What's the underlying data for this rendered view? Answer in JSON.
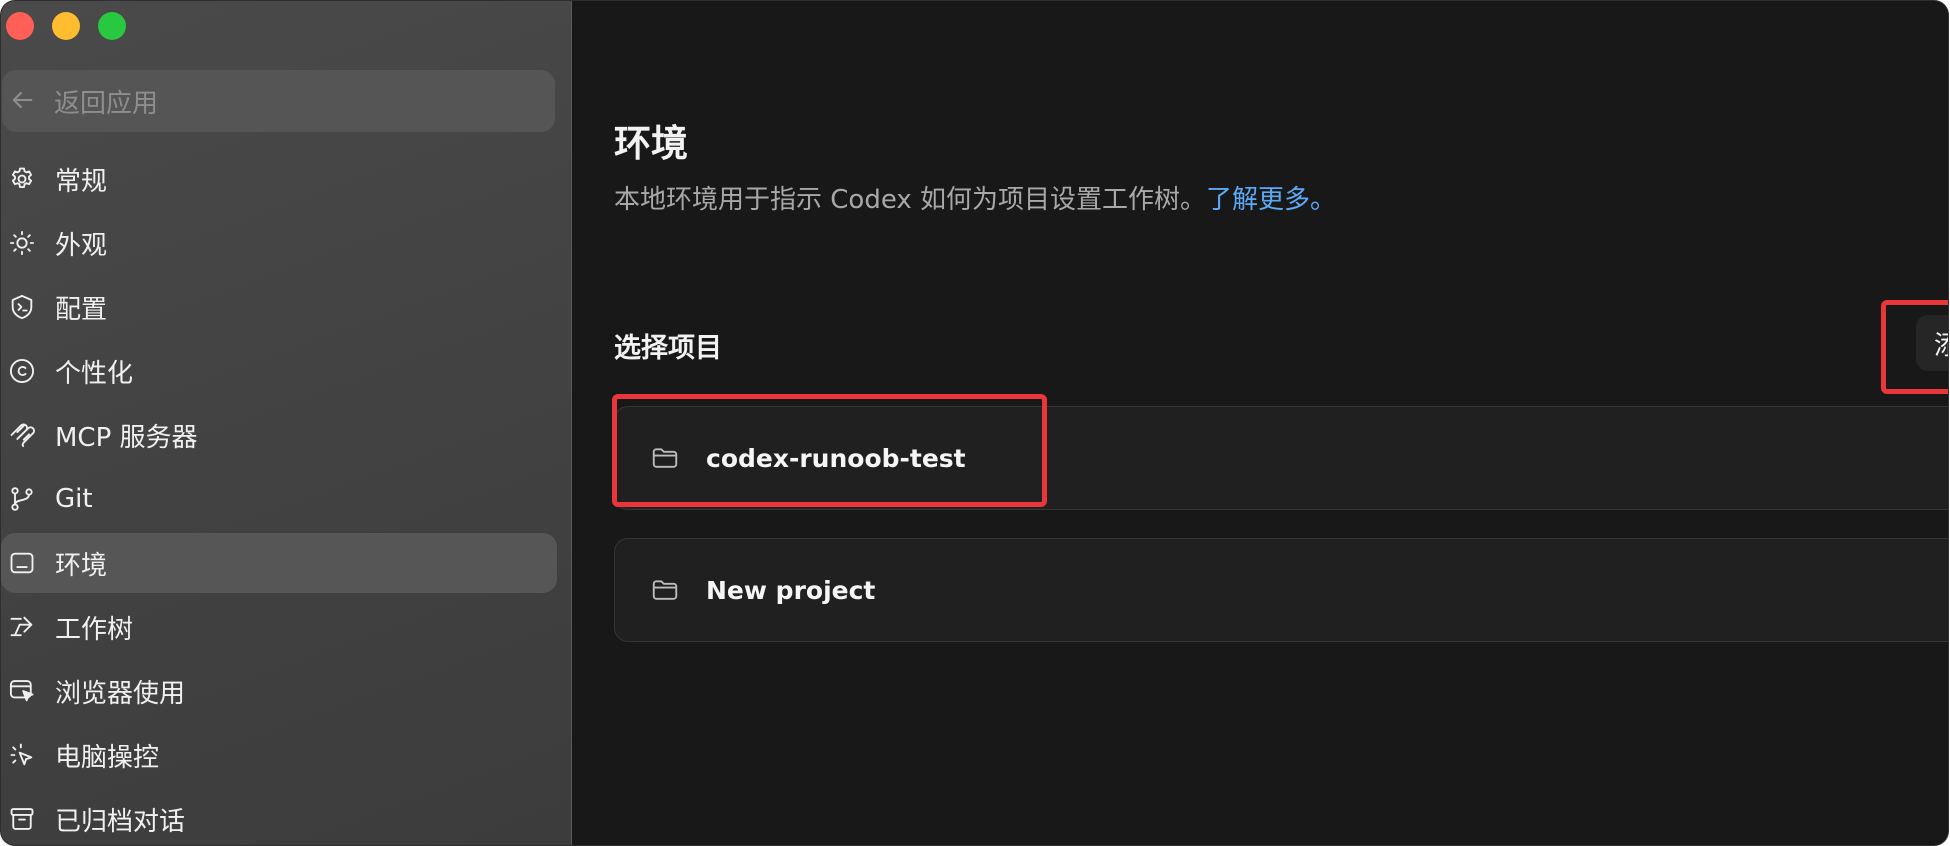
{
  "window": {
    "traffic_lights": [
      "close",
      "minimize",
      "zoom"
    ]
  },
  "sidebar": {
    "back_label": "返回应用",
    "items": [
      {
        "label": "常规",
        "icon": "gear-icon",
        "active": false
      },
      {
        "label": "外观",
        "icon": "sun-icon",
        "active": false
      },
      {
        "label": "配置",
        "icon": "terminal-shield-icon",
        "active": false
      },
      {
        "label": "个性化",
        "icon": "personalization-icon",
        "active": false
      },
      {
        "label": "MCP 服务器",
        "icon": "mcp-icon",
        "active": false
      },
      {
        "label": "Git",
        "icon": "git-branch-icon",
        "active": false
      },
      {
        "label": "环境",
        "icon": "terminal-window-icon",
        "active": true
      },
      {
        "label": "工作树",
        "icon": "worktree-icon",
        "active": false
      },
      {
        "label": "浏览器使用",
        "icon": "browser-cursor-icon",
        "active": false
      },
      {
        "label": "电脑操控",
        "icon": "click-cursor-icon",
        "active": false
      },
      {
        "label": "已归档对话",
        "icon": "archive-icon",
        "active": false
      }
    ]
  },
  "main": {
    "title": "环境",
    "description": "本地环境用于指示 Codex 如何为项目设置工作树。",
    "learn_more": "了解更多。",
    "section_title": "选择项目",
    "add_project_label": "添加项目",
    "projects": [
      {
        "name": "codex-runoob-test"
      },
      {
        "name": "New project"
      }
    ]
  },
  "colors": {
    "accent_link": "#5ea9f5",
    "highlight_red": "#e8363b",
    "main_bg": "#181818",
    "sidebar_bg": "#444444"
  }
}
